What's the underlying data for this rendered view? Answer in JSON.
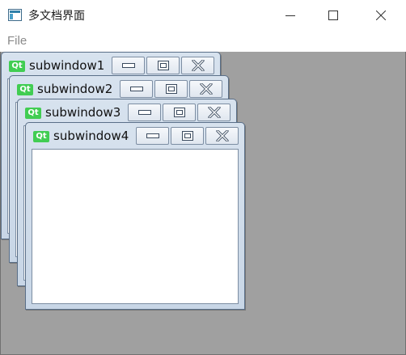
{
  "window": {
    "title": "多文档界面",
    "icon": "app-window-icon",
    "controls": [
      "minimize-icon",
      "maximize-icon",
      "close-icon"
    ]
  },
  "menubar": {
    "items": [
      {
        "label": "File"
      }
    ]
  },
  "subwindows": [
    {
      "title": "subwindow1",
      "logo": "Qt"
    },
    {
      "title": "subwindow2",
      "logo": "Qt"
    },
    {
      "title": "subwindow3",
      "logo": "Qt"
    },
    {
      "title": "subwindow4",
      "logo": "Qt"
    }
  ],
  "colors": {
    "mdi_background": "#a0a0a0",
    "subwindow_frame": "#c8d6e6",
    "qt_green": "#41cd52",
    "menu_text": "#8a8a8a"
  }
}
